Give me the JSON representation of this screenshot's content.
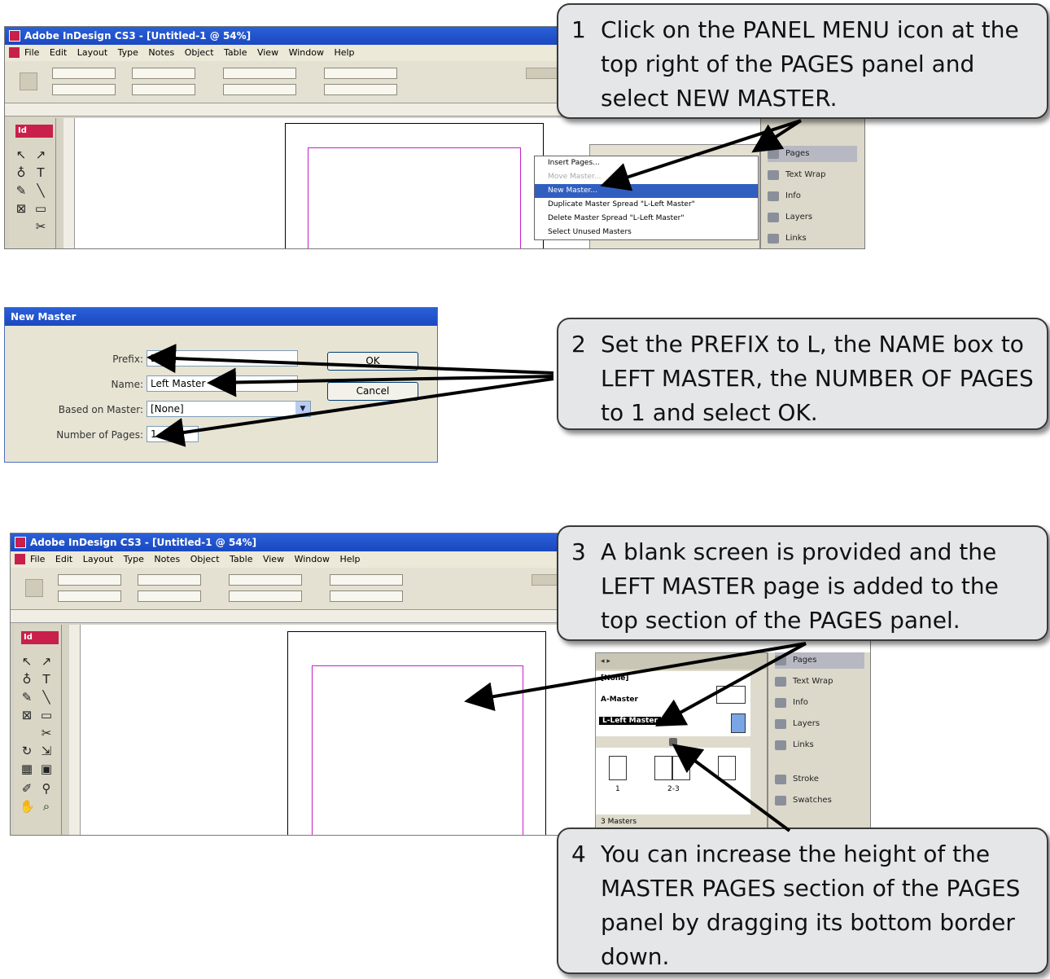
{
  "colors": {
    "callout_bg": "#e5e6e8",
    "titlebar": "#1f52cc",
    "menu_highlight": "#315fc0",
    "margin_guide": "#c61fc8",
    "indesign_logo": "#c8204a"
  },
  "shot1": {
    "window_title": "Adobe InDesign CS3 - [Untitled-1 @ 54%]",
    "menu": [
      "File",
      "Edit",
      "Layout",
      "Type",
      "Notes",
      "Object",
      "Table",
      "View",
      "Window",
      "Help"
    ],
    "panel_menu_items": [
      "Insert Pages...",
      "Move Master...",
      "New Master...",
      "Duplicate Master Spread \"L-Left Master\"",
      "Delete Master Spread \"L-Left Master\"",
      "Select Unused Masters"
    ],
    "side_tabs": [
      "Pages",
      "Text Wrap",
      "Info",
      "Layers",
      "Links"
    ]
  },
  "dialog": {
    "title": "New Master",
    "prefix_label": "Prefix:",
    "prefix_value": "L",
    "name_label": "Name:",
    "name_value": "Left Master",
    "based_label": "Based on Master:",
    "based_value": "[None]",
    "pages_label": "Number of Pages:",
    "pages_value": "1",
    "ok_label": "OK",
    "cancel_label": "Cancel"
  },
  "shot3": {
    "window_title": "Adobe InDesign CS3 - [Untitled-1 @ 54%]",
    "menu": [
      "File",
      "Edit",
      "Layout",
      "Type",
      "Notes",
      "Object",
      "Table",
      "View",
      "Window",
      "Help"
    ],
    "pages_masters": [
      "[None]",
      "A-Master",
      "L-Left Master"
    ],
    "page_numbers": [
      "1",
      "2-3"
    ],
    "masters_footer": "3 Masters",
    "side_tabs": [
      "Pages",
      "Text Wrap",
      "Info",
      "Layers",
      "Links",
      "Stroke",
      "Swatches"
    ]
  },
  "callouts": {
    "c1_num": "1",
    "c1_text": "Click on the PANEL MENU icon at the top right of the PAGES panel and select NEW MASTER.",
    "c2_num": "2",
    "c2_text": "Set the PREFIX to L, the NAME box to LEFT MASTER, the NUMBER OF PAGES to 1 and select OK.",
    "c3_num": "3",
    "c3_text": "A blank screen is provided and the LEFT MASTER page is added to the top section of the PAGES panel.",
    "c4_num": "4",
    "c4_text": "You can increase the height of the MASTER PAGES section of the PAGES panel by dragging its bottom border down."
  }
}
